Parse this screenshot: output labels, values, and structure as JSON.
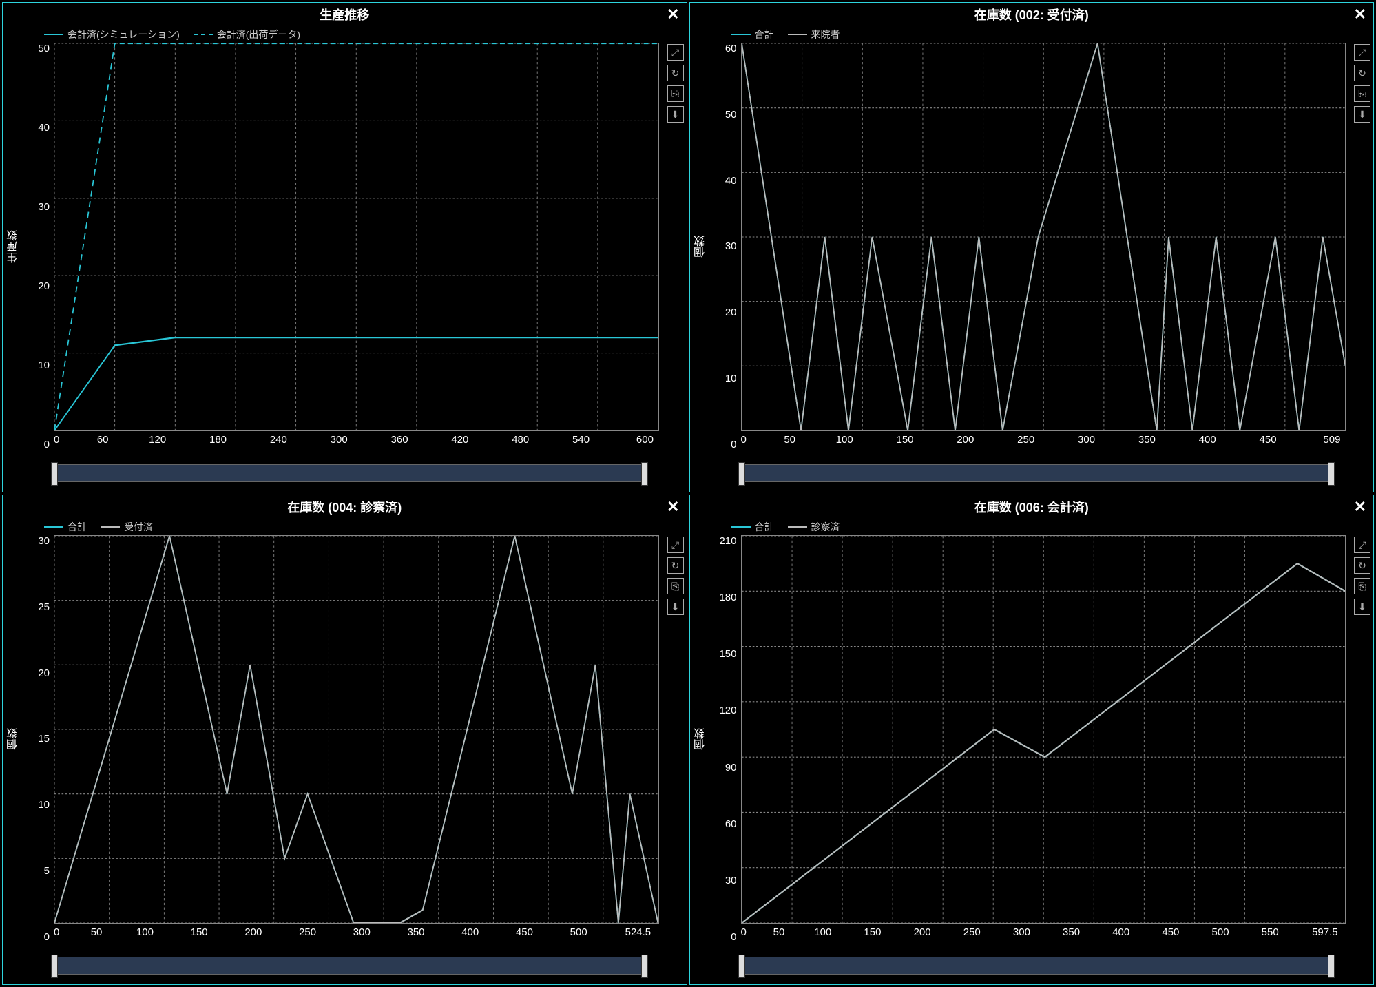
{
  "colors": {
    "accent": "#29c6d6",
    "grey": "#bbbbbb"
  },
  "panels": [
    {
      "id": "p0",
      "title": "生産推移",
      "ylabel": "生産数",
      "legend": [
        {
          "label": "会計済(シミュレーション)",
          "color": "#29c6d6",
          "dashed": false
        },
        {
          "label": "会計済(出荷データ)",
          "color": "#29c6d6",
          "dashed": true
        }
      ],
      "xticks": [
        "0",
        "60",
        "120",
        "180",
        "240",
        "300",
        "360",
        "420",
        "480",
        "540",
        "600"
      ],
      "yticks": [
        "50",
        "40",
        "30",
        "20",
        "10",
        "0"
      ],
      "xmax": 600,
      "ymax": 50
    },
    {
      "id": "p1",
      "title": "在庫数 (002: 受付済)",
      "ylabel": "個数",
      "legend": [
        {
          "label": "合計",
          "color": "#29c6d6",
          "dashed": false
        },
        {
          "label": "来院者",
          "color": "#bbbbbb",
          "dashed": false
        }
      ],
      "xticks": [
        "0",
        "50",
        "100",
        "150",
        "200",
        "250",
        "300",
        "350",
        "400",
        "450",
        "509"
      ],
      "yticks": [
        "60",
        "50",
        "40",
        "30",
        "20",
        "10",
        "0"
      ],
      "xmax": 509,
      "ymax": 60
    },
    {
      "id": "p2",
      "title": "在庫数 (004: 診察済)",
      "ylabel": "個数",
      "legend": [
        {
          "label": "合計",
          "color": "#29c6d6",
          "dashed": false
        },
        {
          "label": "受付済",
          "color": "#bbbbbb",
          "dashed": false
        }
      ],
      "xticks": [
        "0",
        "50",
        "100",
        "150",
        "200",
        "250",
        "300",
        "350",
        "400",
        "450",
        "500",
        "524.5"
      ],
      "yticks": [
        "30",
        "25",
        "20",
        "15",
        "10",
        "5",
        "0"
      ],
      "xmax": 524.5,
      "ymax": 30
    },
    {
      "id": "p3",
      "title": "在庫数 (006: 会計済)",
      "ylabel": "個数",
      "legend": [
        {
          "label": "合計",
          "color": "#29c6d6",
          "dashed": false
        },
        {
          "label": "診察済",
          "color": "#bbbbbb",
          "dashed": false
        }
      ],
      "xticks": [
        "0",
        "50",
        "100",
        "150",
        "200",
        "250",
        "300",
        "350",
        "400",
        "450",
        "500",
        "550",
        "597.5"
      ],
      "yticks": [
        "210",
        "180",
        "150",
        "120",
        "90",
        "60",
        "30",
        "0"
      ],
      "xmax": 597.5,
      "ymax": 210
    }
  ],
  "toolbar_icons": [
    "expand-icon",
    "refresh-icon",
    "copy-icon",
    "download-icon"
  ],
  "chart_data": [
    {
      "type": "line",
      "title": "生産推移",
      "xlabel": "",
      "ylabel": "生産数",
      "xlim": [
        0,
        600
      ],
      "ylim": [
        0,
        50
      ],
      "series": [
        {
          "name": "会計済(シミュレーション)",
          "style": "solid",
          "x": [
            0,
            60,
            120,
            600
          ],
          "values": [
            0,
            11,
            12,
            12
          ]
        },
        {
          "name": "会計済(出荷データ)",
          "style": "dashed",
          "x": [
            0,
            60,
            600
          ],
          "values": [
            0,
            50,
            50
          ]
        }
      ]
    },
    {
      "type": "line",
      "title": "在庫数 (002: 受付済)",
      "xlabel": "",
      "ylabel": "個数",
      "xlim": [
        0,
        509
      ],
      "ylim": [
        0,
        60
      ],
      "series": [
        {
          "name": "合計",
          "style": "solid",
          "x": [
            0,
            50,
            70,
            90,
            110,
            140,
            160,
            180,
            200,
            220,
            250,
            300,
            350,
            360,
            380,
            400,
            420,
            450,
            470,
            490,
            509
          ],
          "values": [
            60,
            0,
            30,
            0,
            30,
            0,
            30,
            0,
            30,
            0,
            30,
            60,
            0,
            30,
            0,
            30,
            0,
            30,
            0,
            30,
            10
          ]
        },
        {
          "name": "来院者",
          "style": "solid",
          "x": [
            0,
            50,
            70,
            90,
            110,
            140,
            160,
            180,
            200,
            220,
            250,
            300,
            350,
            360,
            380,
            400,
            420,
            450,
            470,
            490,
            509
          ],
          "values": [
            60,
            0,
            30,
            0,
            30,
            0,
            30,
            0,
            30,
            0,
            30,
            60,
            0,
            30,
            0,
            30,
            0,
            30,
            0,
            30,
            10
          ]
        }
      ]
    },
    {
      "type": "line",
      "title": "在庫数 (004: 診察済)",
      "xlabel": "",
      "ylabel": "個数",
      "xlim": [
        0,
        524.5
      ],
      "ylim": [
        0,
        30
      ],
      "series": [
        {
          "name": "合計",
          "style": "solid",
          "x": [
            0,
            100,
            150,
            170,
            200,
            220,
            260,
            300,
            320,
            400,
            450,
            470,
            490,
            500,
            524.5
          ],
          "values": [
            0,
            30,
            10,
            20,
            5,
            10,
            0,
            0,
            1,
            30,
            10,
            20,
            0,
            10,
            0
          ]
        },
        {
          "name": "受付済",
          "style": "solid",
          "x": [
            0,
            100,
            150,
            170,
            200,
            220,
            260,
            300,
            320,
            400,
            450,
            470,
            490,
            500,
            524.5
          ],
          "values": [
            0,
            30,
            10,
            20,
            5,
            10,
            0,
            0,
            1,
            30,
            10,
            20,
            0,
            10,
            0
          ]
        }
      ]
    },
    {
      "type": "line",
      "title": "在庫数 (006: 会計済)",
      "xlabel": "",
      "ylabel": "個数",
      "xlim": [
        0,
        597.5
      ],
      "ylim": [
        0,
        210
      ],
      "series": [
        {
          "name": "合計",
          "style": "solid",
          "x": [
            0,
            250,
            300,
            550,
            597.5
          ],
          "values": [
            0,
            105,
            90,
            195,
            180
          ]
        },
        {
          "name": "診察済",
          "style": "solid",
          "x": [
            0,
            250,
            300,
            550,
            597.5
          ],
          "values": [
            0,
            105,
            90,
            195,
            180
          ]
        }
      ]
    }
  ]
}
